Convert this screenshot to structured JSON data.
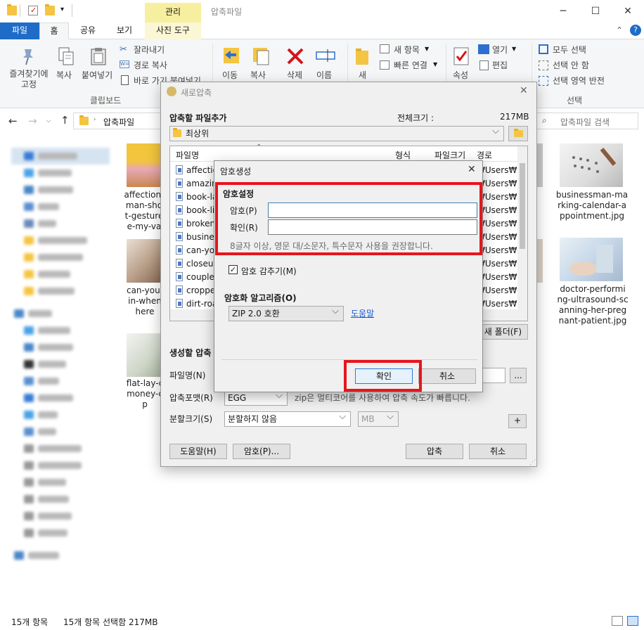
{
  "window": {
    "title": "압축파일",
    "manage_tab_header": "관리",
    "minimize": "─",
    "maximize": "☐",
    "close": "✕"
  },
  "ribbon_tabs": {
    "file": "파일",
    "home": "홈",
    "share": "공유",
    "view": "보기",
    "photo_tools": "사진 도구"
  },
  "ribbon": {
    "pin": "즐겨찾기에\n고정",
    "copy": "복사",
    "paste": "붙여넣기",
    "cut": "잘라내기",
    "copy_path": "경로 복사",
    "paste_shortcut": "바로 가기 붙여넣기",
    "clipboard_group": "클립보드",
    "move_to": "이동",
    "copy_to": "복사",
    "delete": "삭제",
    "rename": "이름",
    "new_folder": "새",
    "new_item": "새 항목",
    "easy_access": "빠른 연결",
    "properties": "속성",
    "open": "열기",
    "edit": "편집",
    "select_all": "모두 선택",
    "select_none": "선택 안 함",
    "invert_selection": "선택 영역 반전",
    "select_group": "선택"
  },
  "address": {
    "path": "압축파일",
    "search_placeholder": "압축파일 검색"
  },
  "files_visible": {
    "f1": [
      "affection-",
      "man-sho",
      "t-gesture",
      "e-my-va"
    ],
    "f2": [
      "can-you-",
      "in-when",
      "here"
    ],
    "f3": [
      "flat-lay-c",
      "money-c",
      "p"
    ],
    "f4": [
      "businessman-ma",
      "rking-calendar-a",
      "ppointment.jpg"
    ],
    "f5": [
      "doctor-performi",
      "ng-ultrasound-sc",
      "anning-her-preg",
      "nant-patient.jpg"
    ]
  },
  "status": {
    "count": "15개 항목",
    "selected": "15개 항목 선택함 217MB"
  },
  "compress_dialog": {
    "title": "새로압축",
    "add_files_label": "압축할 파일추가",
    "total_size_label": "전체크기 :",
    "total_size_value": "217MB",
    "location": "최상위",
    "col_name": "파일명",
    "col_type": "형식",
    "col_size": "파일크기",
    "col_path": "경로",
    "files": [
      "affectio",
      "amazing",
      "book-la",
      "book-lil",
      "broken-",
      "busines",
      "can-you",
      "closeup",
      "couple-",
      "cropped",
      "dirt-roa"
    ],
    "path_prefix": "₩Users₩",
    "new_folder_btn": "새 폴더(F)",
    "output_section": "생성할 압축",
    "filename_label": "파일명(N)",
    "browse": "...",
    "format_label": "압축포맷(R)",
    "format_value": "EGG",
    "format_hint": "zip은 멀티코어를 사용하여 압축 속도가 빠릅니다.",
    "split_label": "분할크기(S)",
    "split_value": "분할하지 않음",
    "split_unit": "MB",
    "plus": "+",
    "help_btn": "도움말(H)",
    "password_btn": "암호(P)...",
    "compress_btn": "압축",
    "cancel_btn": "취소"
  },
  "password_dialog": {
    "title": "암호생성",
    "section": "암호설정",
    "password_label": "암호(P)",
    "password_value": "",
    "confirm_label": "확인(R)",
    "confirm_value": "",
    "hint": "8글자 이상, 영문 대/소문자, 특수문자 사용을 권장합니다.",
    "hide_label": "암호 감추기(M)",
    "hide_checked": true,
    "algo_label": "암호화 알고리즘(O)",
    "algo_value": "ZIP 2.0 호환",
    "help_link": "도움말",
    "ok_btn": "확인",
    "cancel_btn": "취소"
  },
  "colors": {
    "accent": "#1e6cc7",
    "highlight": "#e8141c",
    "manage_tab": "#f7efa0"
  }
}
